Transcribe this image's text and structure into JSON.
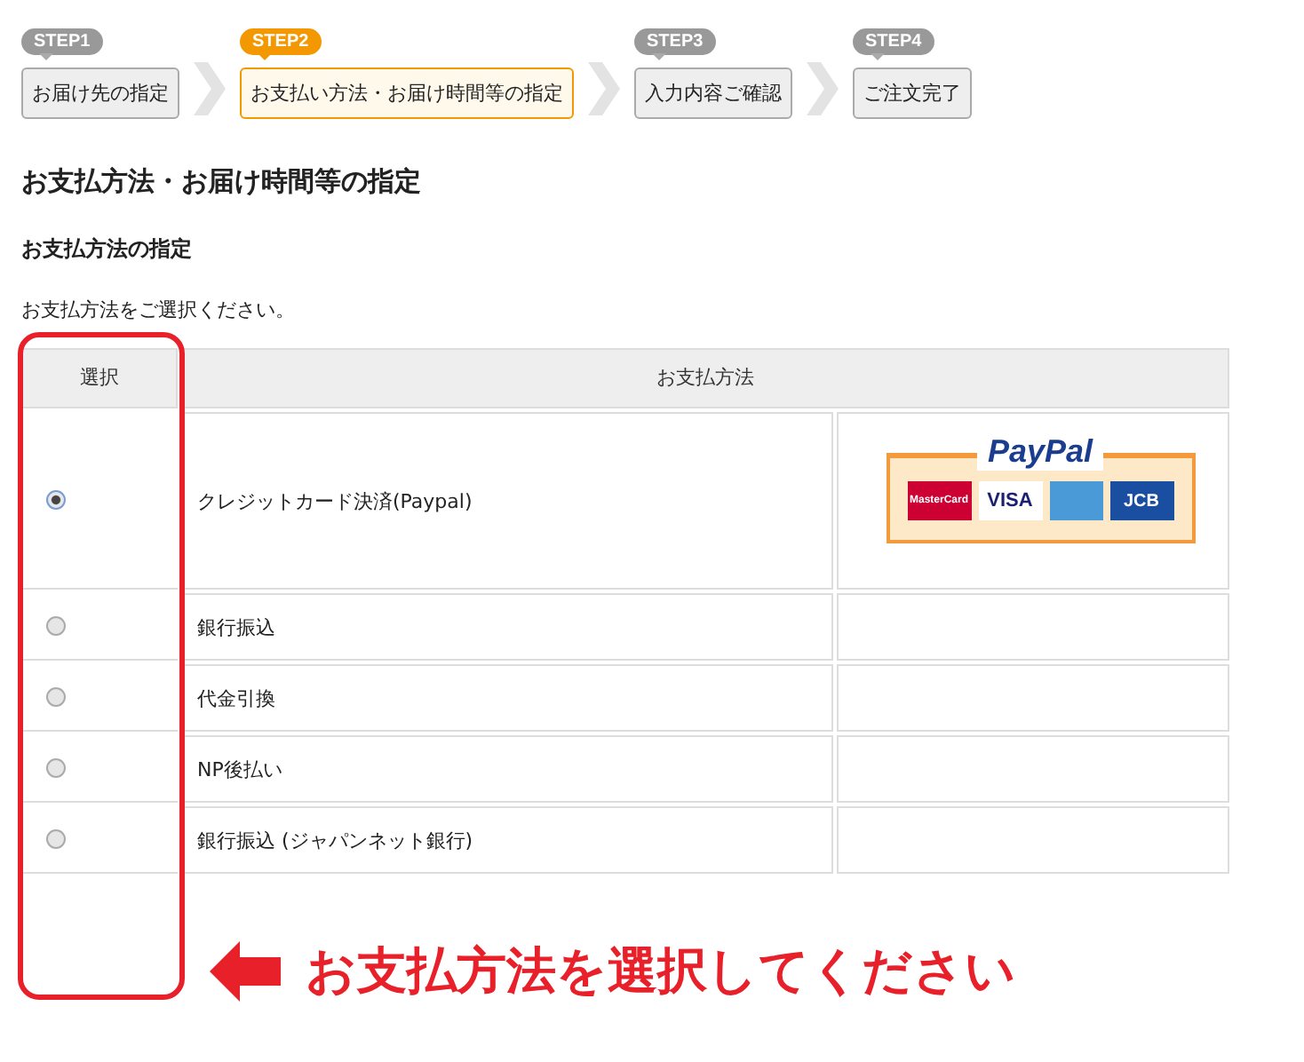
{
  "steps": [
    {
      "badge": "STEP1",
      "label": "お届け先の指定",
      "selected": false
    },
    {
      "badge": "STEP2",
      "label": "お支払い方法・お届け時間等の指定",
      "selected": true
    },
    {
      "badge": "STEP3",
      "label": "入力内容ご確認",
      "selected": false
    },
    {
      "badge": "STEP4",
      "label": "ご注文完了",
      "selected": false
    }
  ],
  "title": "お支払方法・お届け時間等の指定",
  "subtitle": "お支払方法の指定",
  "instruction": "お支払方法をご選択ください。",
  "table": {
    "columns": [
      "選択",
      "お支払方法"
    ],
    "rows": [
      {
        "method": "クレジットカード決済(Paypal)",
        "selected": true,
        "logo": {
          "brand": "PayPal",
          "cards": [
            "MasterCard",
            "VISA",
            "JCB"
          ]
        }
      },
      {
        "method": "銀行振込",
        "selected": false
      },
      {
        "method": "代金引換",
        "selected": false
      },
      {
        "method": "NP後払い",
        "selected": false
      },
      {
        "method": "銀行振込 (ジャパンネット銀行)",
        "selected": false
      }
    ]
  },
  "callout": "お支払方法を選択してください"
}
